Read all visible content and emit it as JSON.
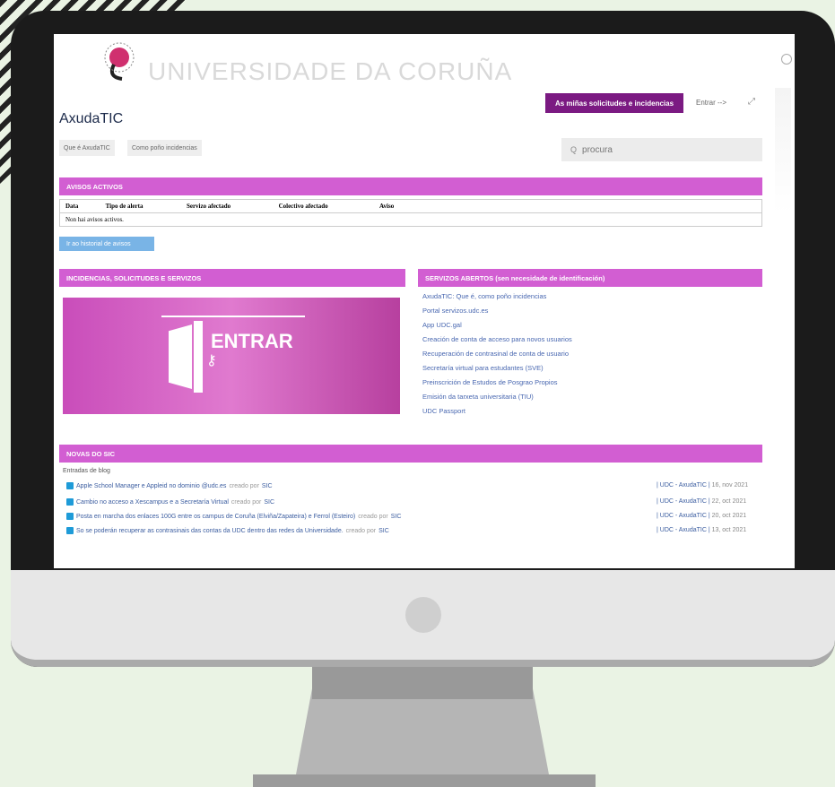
{
  "header": {
    "university": "UNIVERSIDADE DA CORUÑA",
    "primary_button": "As miñas solicitudes e incidencias",
    "login_link": "Entrar -->",
    "app_title": "AxudaTIC",
    "tabs": [
      "Que é AxudaTIC",
      "Como poño incidencias"
    ],
    "search_placeholder": "procura"
  },
  "alerts": {
    "heading": "AVISOS ACTIVOS",
    "columns": [
      "Data",
      "Tipo de alerta",
      "Servizo afectado",
      "Colectivo afectado",
      "Aviso"
    ],
    "empty": "Non hai avisos activos.",
    "history_button": "Ir ao historial de avisos"
  },
  "incidents": {
    "heading": "INCIDENCIAS, SOLICITUDES E SERVIZOS",
    "banner": "ENTRAR"
  },
  "open_services": {
    "heading": "SERVIZOS ABERTOS (sen necesidade de identificación)",
    "items": [
      "AxudaTIC: Que é, como poño incidencias",
      "Portal servizos.udc.es",
      "App UDC.gal",
      "Creación de conta de acceso para novos usuarios",
      "Recuperación de contrasinal de conta de usuario",
      "Secretaría virtual para estudantes (SVE)",
      "Preinscrición de Estudos de Posgrao Propios",
      "Emisión da tarxeta universitaria (TIU)",
      "UDC Passport"
    ]
  },
  "news": {
    "heading": "NOVAS DO SIC",
    "subheading": "Entradas de blog",
    "entries": [
      {
        "title": "Apple School Manager e Appleid no dominio @udc.es",
        "by": "creado por",
        "author": "SIC",
        "source": "| UDC - AxudaTIC |",
        "date": "16, nov 2021"
      },
      {
        "title": "Cambio no acceso a Xescampus e a Secretaría Virtual",
        "by": "creado por",
        "author": "SIC",
        "source": "| UDC - AxudaTIC |",
        "date": "22, oct 2021"
      },
      {
        "title": "Posta en marcha dos enlaces 100G entre os campus de Coruña (Elviña/Zapateira) e Ferrol (Esteiro)",
        "by": "creado por",
        "author": "SIC",
        "source": "| UDC - AxudaTIC |",
        "date": "20, oct 2021"
      },
      {
        "title": "So se poderán recuperar as contrasinais das contas da UDC dentro das redes da Universidade.",
        "by": "creado por",
        "author": "SIC",
        "source": "| UDC - AxudaTIC |",
        "date": "13, oct 2021"
      }
    ]
  },
  "colors": {
    "accent": "#d25ed2",
    "primary": "#7b1a82",
    "link": "#4867b0"
  }
}
